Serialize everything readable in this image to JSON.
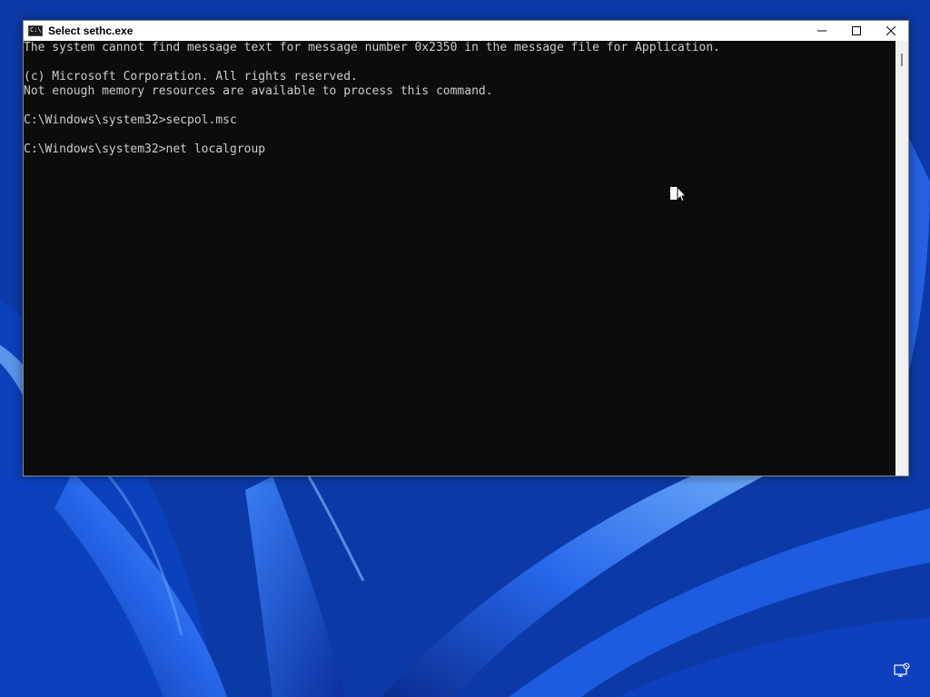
{
  "window": {
    "title": "Select sethc.exe",
    "icon": "cmd-icon",
    "controls": [
      "minimize-icon",
      "maximize-icon",
      "close-icon"
    ]
  },
  "console": {
    "lines": [
      "The system cannot find message text for message number 0x2350 in the message file for Application.",
      "",
      "(c) Microsoft Corporation. All rights reserved.",
      "Not enough memory resources are available to process this command.",
      "",
      "C:\\Windows\\system32>secpol.msc",
      "",
      "C:\\Windows\\system32>net localgroup"
    ]
  },
  "taskbar": {
    "tray_icon": "network-icon"
  }
}
